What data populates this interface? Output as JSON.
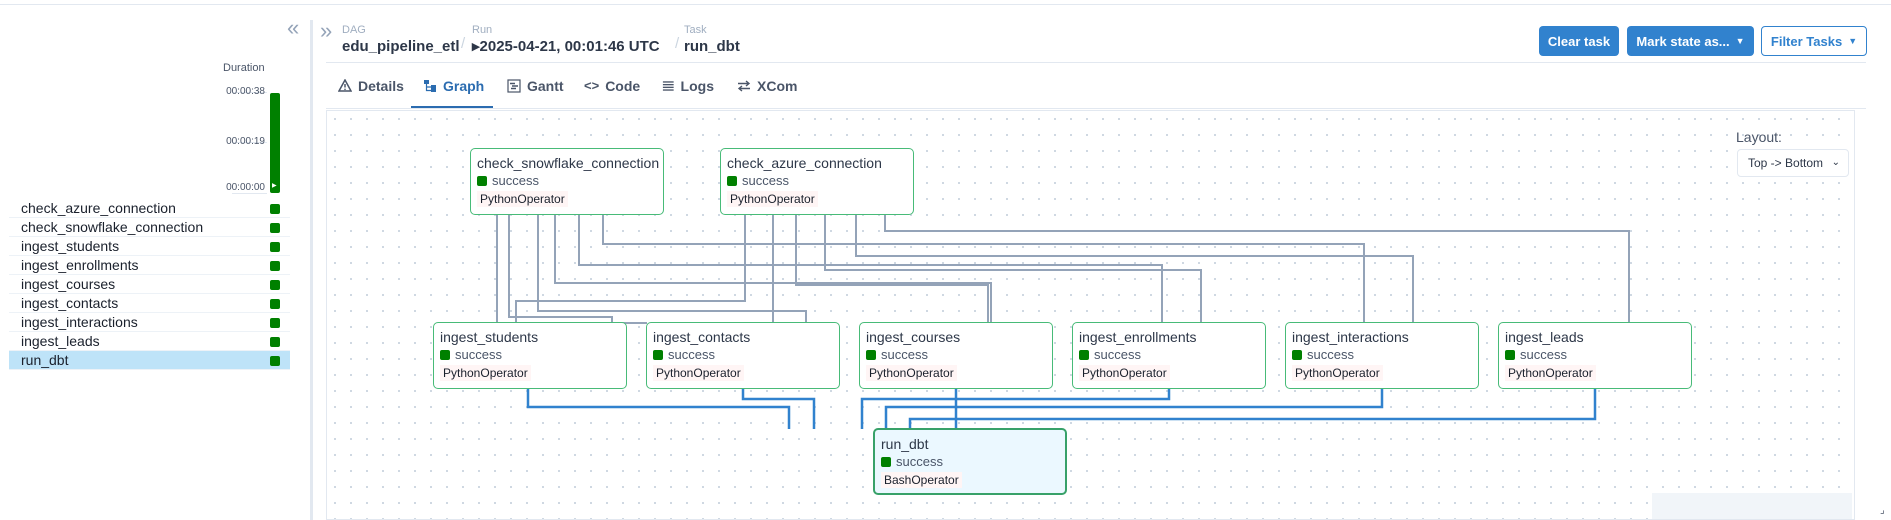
{
  "grid": {
    "duration_title": "Duration",
    "duration_ticks": [
      "00:00:38",
      "00:00:19",
      "00:00:00"
    ],
    "tasks": [
      {
        "name": "check_azure_connection",
        "selected": false
      },
      {
        "name": "check_snowflake_connection",
        "selected": false
      },
      {
        "name": "ingest_students",
        "selected": false
      },
      {
        "name": "ingest_enrollments",
        "selected": false
      },
      {
        "name": "ingest_courses",
        "selected": false
      },
      {
        "name": "ingest_contacts",
        "selected": false
      },
      {
        "name": "ingest_interactions",
        "selected": false
      },
      {
        "name": "ingest_leads",
        "selected": false
      },
      {
        "name": "run_dbt",
        "selected": true
      }
    ]
  },
  "breadcrumb": {
    "dag_label": "DAG",
    "dag_value": "edu_pipeline_etl",
    "run_label": "Run",
    "run_value": "▸2025-04-21, 00:01:46 UTC",
    "task_label": "Task",
    "task_value": "run_dbt"
  },
  "buttons": {
    "clear_task": "Clear task",
    "mark_state": "Mark state as...",
    "filter_tasks": "Filter Tasks"
  },
  "tabs": [
    {
      "label": "Details",
      "icon": "warning-icon"
    },
    {
      "label": "Graph",
      "icon": "graph-icon"
    },
    {
      "label": "Gantt",
      "icon": "gantt-icon"
    },
    {
      "label": "Code",
      "icon": "code-icon"
    },
    {
      "label": "Logs",
      "icon": "logs-icon"
    },
    {
      "label": "XCom",
      "icon": "xcom-icon"
    }
  ],
  "graph": {
    "layout_label": "Layout:",
    "layout_value": "Top -> Bottom",
    "nodes": [
      {
        "id": "check_snowflake_connection",
        "state": "success",
        "operator": "PythonOperator"
      },
      {
        "id": "check_azure_connection",
        "state": "success",
        "operator": "PythonOperator"
      },
      {
        "id": "ingest_students",
        "state": "success",
        "operator": "PythonOperator"
      },
      {
        "id": "ingest_contacts",
        "state": "success",
        "operator": "PythonOperator"
      },
      {
        "id": "ingest_courses",
        "state": "success",
        "operator": "PythonOperator"
      },
      {
        "id": "ingest_enrollments",
        "state": "success",
        "operator": "PythonOperator"
      },
      {
        "id": "ingest_interactions",
        "state": "success",
        "operator": "PythonOperator"
      },
      {
        "id": "ingest_leads",
        "state": "success",
        "operator": "PythonOperator"
      },
      {
        "id": "run_dbt",
        "state": "success",
        "operator": "BashOperator"
      }
    ]
  },
  "colors": {
    "success": "#008000",
    "accent": "#3182ce",
    "edge_upstream": "#94a3b8",
    "edge_selected": "#3182ce"
  }
}
